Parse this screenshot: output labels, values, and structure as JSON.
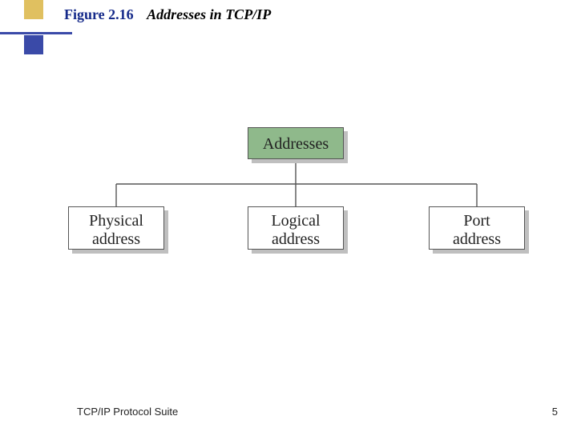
{
  "heading": {
    "figure_number": "Figure 2.16",
    "title": "Addresses in TCP/IP"
  },
  "diagram": {
    "root": {
      "label": "Addresses",
      "fill": "#8fb98b"
    },
    "children": [
      {
        "label": "Physical\naddress"
      },
      {
        "label": "Logical\naddress"
      },
      {
        "label": "Port\naddress"
      }
    ]
  },
  "footer": {
    "source": "TCP/IP Protocol Suite",
    "page_number": "5"
  }
}
